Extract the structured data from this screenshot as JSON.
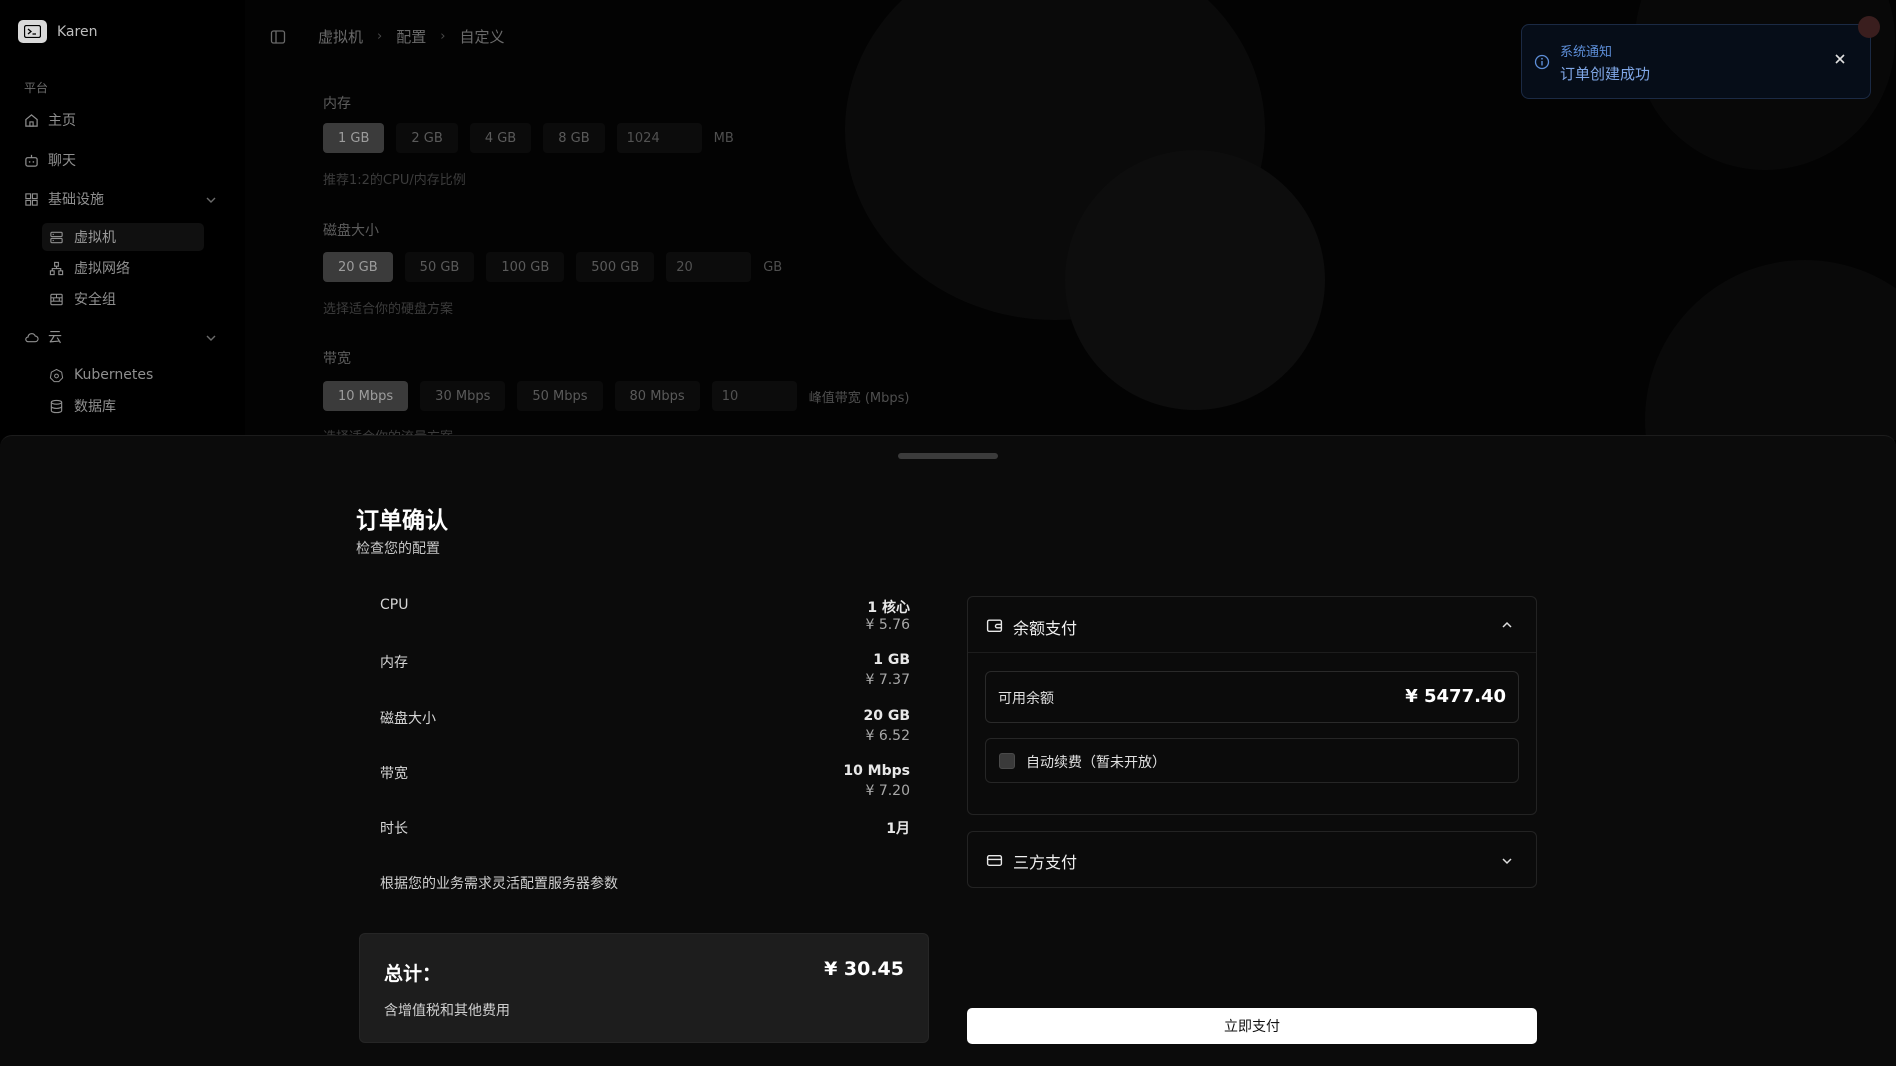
{
  "brand": {
    "name": "Karen",
    "icon": "terminal-logo-icon"
  },
  "sidebar": {
    "section_label": "平台",
    "items": [
      {
        "label": "主页",
        "icon": "home-icon"
      },
      {
        "label": "聊天",
        "icon": "chat-bot-icon"
      }
    ],
    "group_infra": {
      "label": "基础设施",
      "icon": "grid-icon",
      "children": [
        {
          "label": "虚拟机",
          "icon": "server-icon",
          "active": true
        },
        {
          "label": "虚拟网络",
          "icon": "network-icon"
        },
        {
          "label": "安全组",
          "icon": "firewall-icon"
        }
      ]
    },
    "group_cloud": {
      "label": "云",
      "icon": "cloud-icon",
      "children": [
        {
          "label": "Kubernetes",
          "icon": "kubernetes-icon"
        },
        {
          "label": "数据库",
          "icon": "database-icon"
        }
      ]
    }
  },
  "breadcrumb": [
    "虚拟机",
    "配置",
    "自定义"
  ],
  "config": {
    "memory": {
      "label": "内存",
      "options": [
        "1 GB",
        "2 GB",
        "4 GB",
        "8 GB"
      ],
      "selected": "1 GB",
      "custom_value": "1024",
      "unit": "MB",
      "hint": "推荐1:2的CPU/内存比例"
    },
    "disk": {
      "label": "磁盘大小",
      "options": [
        "20 GB",
        "50 GB",
        "100 GB",
        "500 GB"
      ],
      "selected": "20 GB",
      "custom_value": "20",
      "unit": "GB",
      "hint": "选择适合你的硬盘方案"
    },
    "bandwidth": {
      "label": "带宽",
      "options": [
        "10 Mbps",
        "30 Mbps",
        "50 Mbps",
        "80 Mbps"
      ],
      "selected": "10 Mbps",
      "custom_value": "10",
      "unit": "峰值带宽 (Mbps)",
      "hint": "选择适合你的流量方案"
    }
  },
  "notification": {
    "title": "系统通知",
    "message": "订单创建成功",
    "colors": {
      "accent": "#5d8ed8",
      "background": "#060d18"
    }
  },
  "order": {
    "title": "订单确认",
    "subtitle": "检查您的配置",
    "items": [
      {
        "label": "CPU",
        "value": "1 核心",
        "price": "¥ 5.76"
      },
      {
        "label": "内存",
        "value": "1 GB",
        "price": "¥ 7.37"
      },
      {
        "label": "磁盘大小",
        "value": "20 GB",
        "price": "¥ 6.52"
      },
      {
        "label": "带宽",
        "value": "10 Mbps",
        "price": "¥ 7.20"
      },
      {
        "label": "时长",
        "value": "1月",
        "price": ""
      }
    ],
    "description": "根据您的业务需求灵活配置服务器参数",
    "total_label": "总计：",
    "total_value": "¥ 30.45",
    "total_note": "含增值税和其他费用"
  },
  "payment": {
    "balance_section": {
      "label": "余额支付",
      "expanded": true,
      "available_label": "可用余额",
      "available_value": "¥ 5477.40",
      "auto_renew_label": "自动续费（暂未开放）",
      "auto_renew_checked": false
    },
    "third_party": {
      "label": "三方支付",
      "expanded": false
    },
    "pay_button": "立即支付"
  }
}
